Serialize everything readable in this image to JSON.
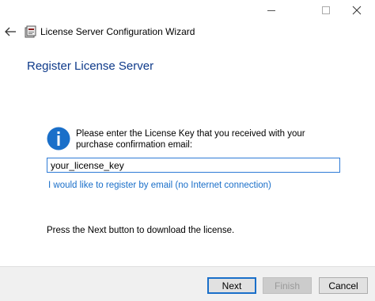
{
  "window": {
    "title": "License Server Configuration Wizard",
    "caption_buttons": [
      "minimize",
      "maximize",
      "close"
    ]
  },
  "page": {
    "heading": "Register License Server",
    "info_text": "Please enter the License Key that you received with your purchase confirmation email:",
    "license_key_value": "your_license_key",
    "email_link": "I would like to register by email (no Internet connection)",
    "instruction": "Press the Next button to download the license."
  },
  "buttons": {
    "next": "Next",
    "finish": "Finish",
    "cancel": "Cancel"
  },
  "icons": {
    "back": "back-arrow-icon",
    "app": "app-icon",
    "info": "info-icon"
  },
  "colors": {
    "heading": "#0e3a8a",
    "link": "#1a6fc9",
    "info_icon": "#1a6fc9",
    "input_border": "#2e7bd6",
    "footer_bg": "#f0f0f0"
  }
}
